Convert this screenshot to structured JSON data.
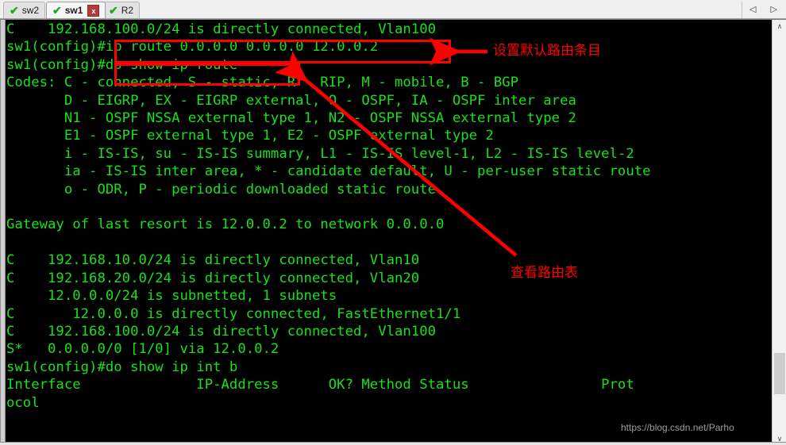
{
  "window": {
    "tabs": [
      {
        "label": "sw2",
        "icon": "check-icon",
        "active": false,
        "closable": false
      },
      {
        "label": "sw1",
        "icon": "check-icon",
        "active": true,
        "closable": true,
        "close_label": "x"
      },
      {
        "label": "R2",
        "icon": "check-icon",
        "active": false,
        "closable": false
      }
    ],
    "tab_nav": {
      "prev": "◁",
      "next": "▷"
    }
  },
  "terminal": {
    "prompt": "sw1(config)#",
    "foreground_color": "#19e019",
    "background_color": "#000000",
    "lines": [
      "C    192.168.100.0/24 is directly connected, Vlan100",
      "sw1(config)#ip route 0.0.0.0 0.0.0.0 12.0.0.2",
      "sw1(config)#do show ip route",
      "Codes: C - connected, S - static, R - RIP, M - mobile, B - BGP",
      "       D - EIGRP, EX - EIGRP external, O - OSPF, IA - OSPF inter area",
      "       N1 - OSPF NSSA external type 1, N2 - OSPF NSSA external type 2",
      "       E1 - OSPF external type 1, E2 - OSPF external type 2",
      "       i - IS-IS, su - IS-IS summary, L1 - IS-IS level-1, L2 - IS-IS level-2",
      "       ia - IS-IS inter area, * - candidate default, U - per-user static route",
      "       o - ODR, P - periodic downloaded static route",
      "",
      "Gateway of last resort is 12.0.0.2 to network 0.0.0.0",
      "",
      "C    192.168.10.0/24 is directly connected, Vlan10",
      "C    192.168.20.0/24 is directly connected, Vlan20",
      "     12.0.0.0/24 is subnetted, 1 subnets",
      "C       12.0.0.0 is directly connected, FastEthernet1/1",
      "C    192.168.100.0/24 is directly connected, Vlan100",
      "S*   0.0.0.0/0 [1/0] via 12.0.0.2",
      "sw1(config)#do show ip int b",
      "Interface              IP-Address      OK? Method Status                Prot",
      "ocol"
    ]
  },
  "annotations": {
    "color": "#fe0000",
    "box_1_caption": "设置默认路由条目",
    "box_2_caption": "查看路由表"
  },
  "watermark": {
    "text": "https://blog.csdn.net/Parho"
  },
  "scrollbar": {
    "up_arrow": "∧",
    "down_arrow": "∨"
  }
}
